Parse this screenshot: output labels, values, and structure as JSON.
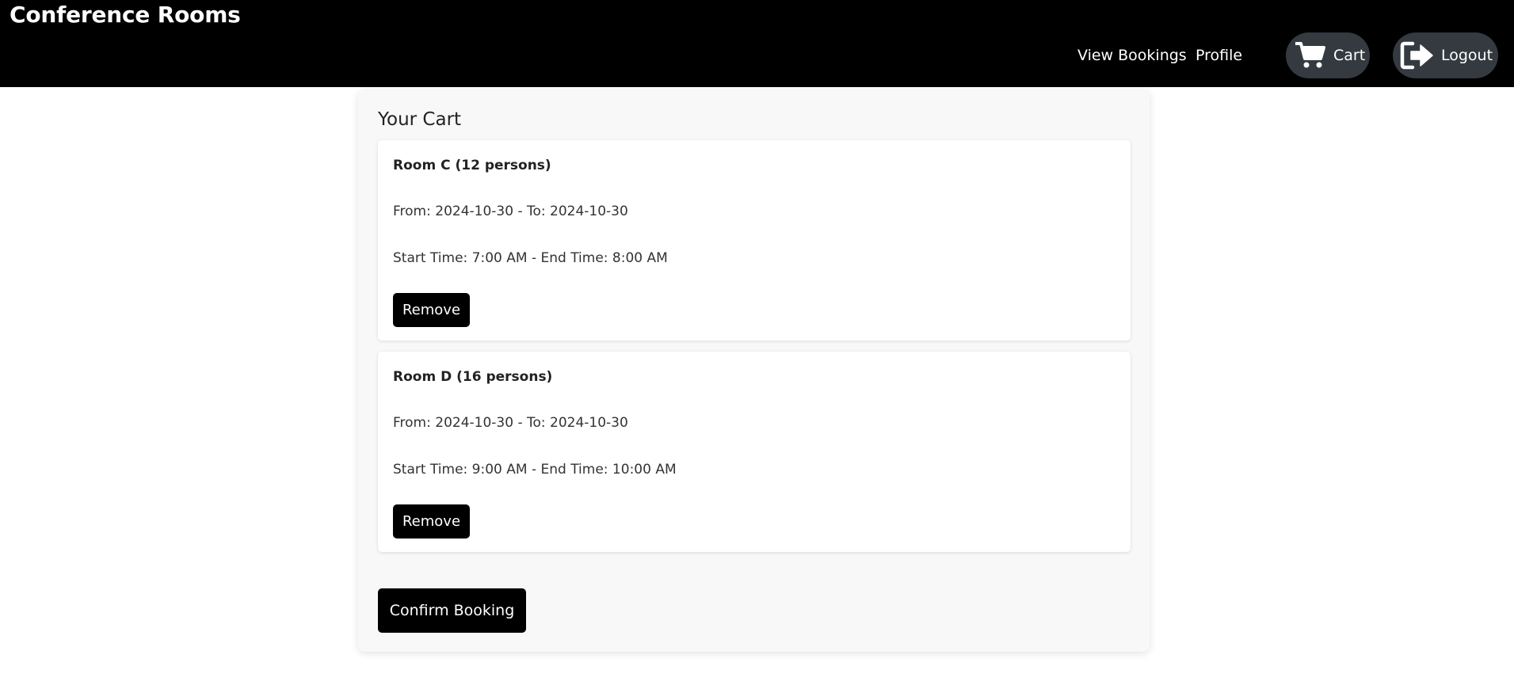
{
  "header": {
    "brand": "Conference Rooms",
    "nav": {
      "view_bookings": "View Bookings",
      "profile": "Profile",
      "cart": "Cart",
      "logout": "Logout"
    },
    "icons": {
      "cart": "shopping-cart-icon",
      "logout": "sign-out-icon"
    }
  },
  "cart": {
    "title": "Your Cart",
    "items": [
      {
        "name": "Room C (12 persons)",
        "dates": "From: 2024-10-30 - To: 2024-10-30",
        "times": "Start Time: 7:00 AM - End Time: 8:00 AM",
        "remove_label": "Remove"
      },
      {
        "name": "Room D (16 persons)",
        "dates": "From: 2024-10-30 - To: 2024-10-30",
        "times": "Start Time: 9:00 AM - End Time: 10:00 AM",
        "remove_label": "Remove"
      }
    ],
    "confirm_label": "Confirm Booking"
  },
  "colors": {
    "navbar": "#000000",
    "pill": "#343a40",
    "panel": "#f8f8f8",
    "button": "#000000"
  }
}
